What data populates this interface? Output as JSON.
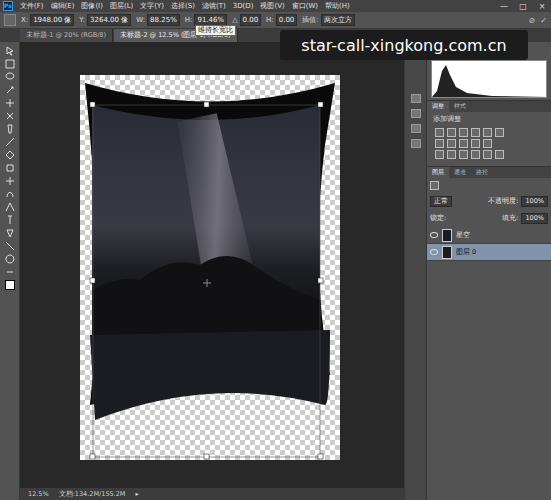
{
  "app": {
    "logo": "Ps"
  },
  "menu": [
    "文件(F)",
    "编辑(E)",
    "图像(I)",
    "图层(L)",
    "文字(Y)",
    "选择(S)",
    "滤镜(T)",
    "3D(D)",
    "视图(V)",
    "窗口(W)",
    "帮助(H)"
  ],
  "window_controls": [
    "—",
    "□",
    "×"
  ],
  "options": [
    {
      "label": "X:",
      "value": "1948.00 像"
    },
    {
      "label": "Y:",
      "value": "3264.00 像"
    },
    {
      "label": "W:",
      "value": "88.25%"
    },
    {
      "label": "H:",
      "value": "91.46%"
    },
    {
      "label": "△",
      "value": "0.00"
    },
    {
      "label": "H:",
      "value": "0.00"
    },
    {
      "label": "插值:",
      "value": "两次立方"
    }
  ],
  "options_end": [
    "⊘",
    "✓"
  ],
  "tooltip": "维持长宽比",
  "watermark": "star-call-xingkong.com.cn",
  "doc_tabs": [
    {
      "label": "未标题-1 @ 20% (RGB/8)",
      "selected": false
    },
    {
      "label": "未标题-2 @ 12.5% (图层 0, RGB/8)",
      "selected": true
    }
  ],
  "adjust_tabs": [
    {
      "label": "调整",
      "selected": true
    },
    {
      "label": "样式",
      "selected": false
    }
  ],
  "adjust_title": "添加调整",
  "layers_tabs": [
    {
      "label": "图层",
      "selected": true
    },
    {
      "label": "通道",
      "selected": false
    },
    {
      "label": "路径",
      "selected": false
    }
  ],
  "blend_mode": "正常",
  "opacity_label": "不透明度:",
  "opacity": "100%",
  "lock_label": "锁定:",
  "fill_label": "填充:",
  "fill": "100%",
  "layers": [
    {
      "name": "星空",
      "selected": false,
      "visible": true
    },
    {
      "name": "图层 0",
      "selected": true,
      "visible": true
    }
  ],
  "status": {
    "zoom": "12.5%",
    "doc": "文档:134.2M/155.2M",
    "arrow": "▸"
  }
}
